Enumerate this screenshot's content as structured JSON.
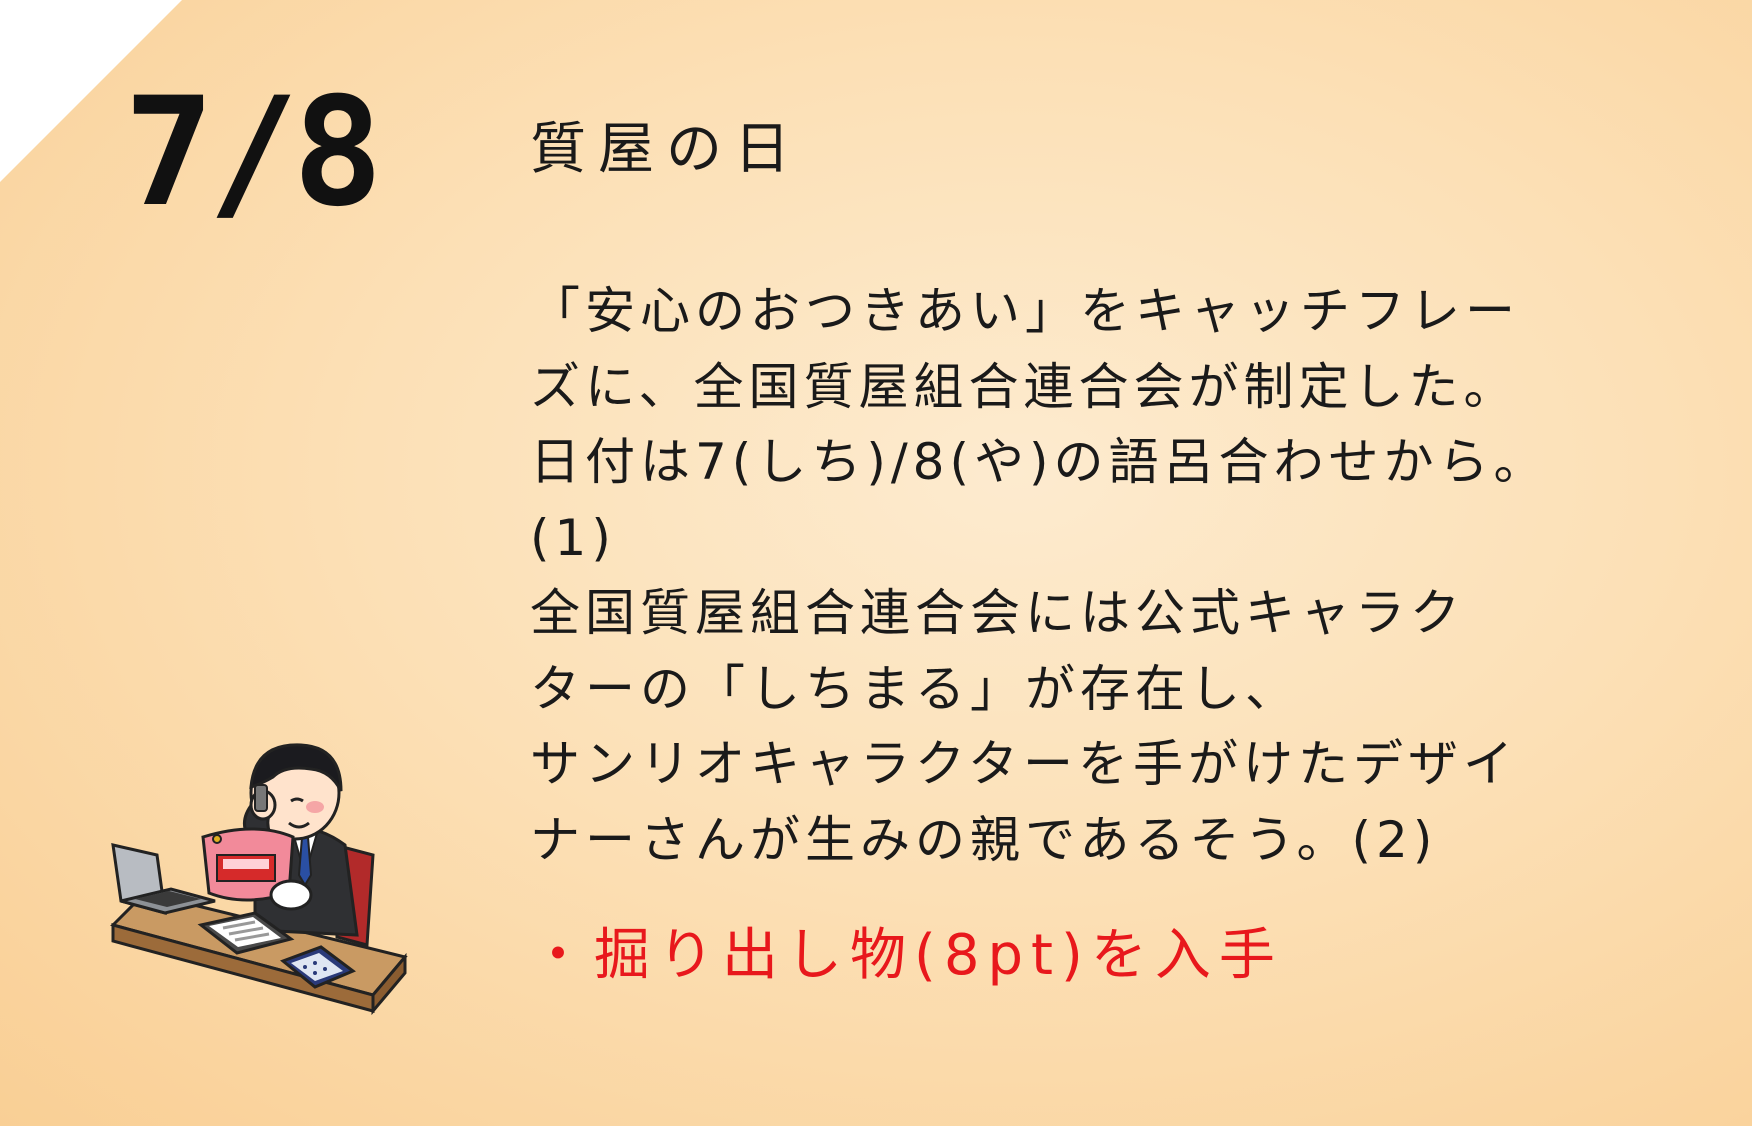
{
  "date": "7/8",
  "title": "質屋の日",
  "body_lines": [
    "「安心のおつきあい」をキャッチフレー",
    "ズに、全国質屋組合連合会が制定した。",
    "日付は7(しち)/8(や)の語呂合わせから。",
    "(1)",
    "全国質屋組合連合会には公式キャラク",
    "ターの「しちまる」が存在し、",
    "サンリオキャラクターを手がけたデザイ",
    "ナーさんが生みの親であるそう。(2)"
  ],
  "reward": "・掘り出し物(8pt)を入手",
  "colors": {
    "background": "#fce0b6",
    "reward_text": "#e8181c",
    "corner": "#ffffff"
  }
}
